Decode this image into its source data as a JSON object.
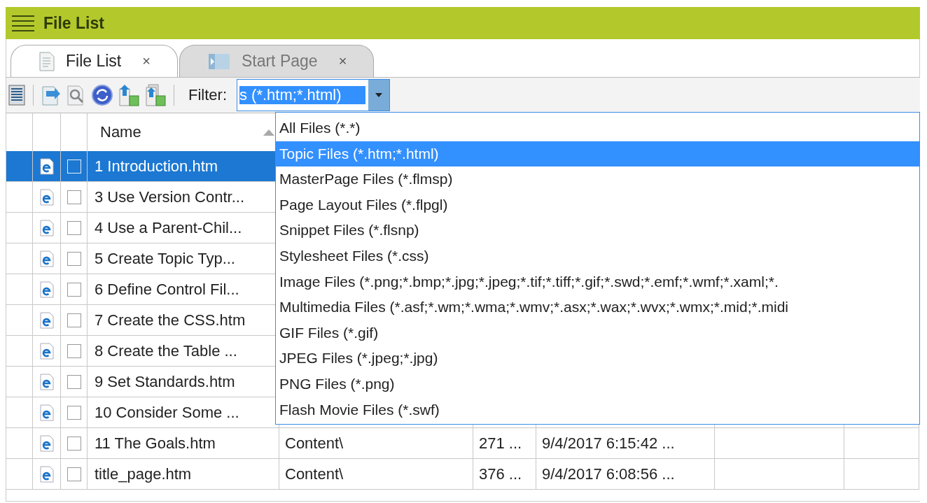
{
  "title_bar": {
    "title": "File List"
  },
  "tabs": [
    {
      "label": "File List",
      "close": "×",
      "selected": true
    },
    {
      "label": "Start Page",
      "close": "×",
      "selected": false
    }
  ],
  "toolbar": {
    "filter_label": "Filter:",
    "filter_value": "s (*.htm;*.html)"
  },
  "table": {
    "columns": [
      {
        "label": "Name",
        "sorted": true
      }
    ],
    "rows": [
      {
        "name": "1 Introduction.htm",
        "selected": true,
        "checked": false
      },
      {
        "name": "3 Use Version Contr...",
        "selected": false,
        "checked": false
      },
      {
        "name": "4 Use a Parent-Chil...",
        "selected": false,
        "checked": false
      },
      {
        "name": "5 Create Topic Typ...",
        "selected": false,
        "checked": false
      },
      {
        "name": "6 Define Control Fil...",
        "selected": false,
        "checked": false
      },
      {
        "name": "7 Create the CSS.htm",
        "selected": false,
        "checked": false
      },
      {
        "name": "8 Create the Table ...",
        "selected": false,
        "checked": false
      },
      {
        "name": "9 Set Standards.htm",
        "selected": false,
        "checked": false
      },
      {
        "name": "10 Consider Some ...",
        "selected": false,
        "checked": false
      },
      {
        "name": "11 The Goals.htm",
        "selected": false,
        "checked": false,
        "path": "Content\\",
        "size": "271 ...",
        "modified": "9/4/2017 6:15:42 ..."
      },
      {
        "name": "title_page.htm",
        "selected": false,
        "checked": false,
        "path": "Content\\",
        "size": "376 ...",
        "modified": "9/4/2017 6:08:56 ..."
      }
    ]
  },
  "filter_dropdown": {
    "items": [
      {
        "label": "All Files (*.*)",
        "selected": false
      },
      {
        "label": "Topic Files (*.htm;*.html)",
        "selected": true
      },
      {
        "label": "MasterPage Files (*.flmsp)",
        "selected": false
      },
      {
        "label": "Page Layout Files (*.flpgl)",
        "selected": false
      },
      {
        "label": "Snippet Files (*.flsnp)",
        "selected": false
      },
      {
        "label": "Stylesheet Files (*.css)",
        "selected": false
      },
      {
        "label": "Image Files (*.png;*.bmp;*.jpg;*.jpeg;*.tif;*.tiff;*.gif;*.swd;*.emf;*.wmf;*.xaml;*.",
        "selected": false
      },
      {
        "label": "Multimedia Files (*.asf;*.wm;*.wma;*.wmv;*.asx;*.wax;*.wvx;*.wmx;*.mid;*.midi",
        "selected": false
      },
      {
        "label": "GIF Files (*.gif)",
        "selected": false
      },
      {
        "label": "JPEG Files (*.jpeg;*.jpg)",
        "selected": false
      },
      {
        "label": "PNG Files (*.png)",
        "selected": false
      },
      {
        "label": "Flash Movie Files (*.swf)",
        "selected": false
      }
    ]
  }
}
